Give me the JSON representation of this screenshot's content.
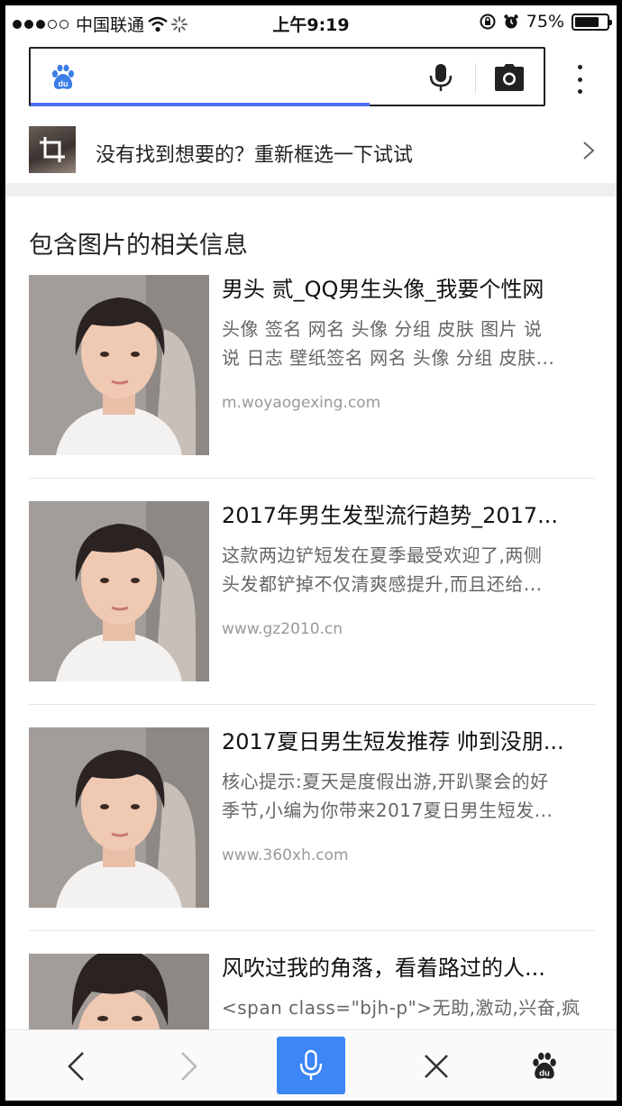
{
  "status_bar": {
    "carrier": "中国联通",
    "time": "上午9:19",
    "battery_text": "75%",
    "battery_level": 0.75
  },
  "search": {
    "query": "",
    "load_progress": 0.66
  },
  "reselect": {
    "text": "没有找到想要的？重新框选一下试试"
  },
  "section": {
    "title": "包含图片的相关信息"
  },
  "results": [
    {
      "title": "男头 贰_QQ男生头像_我要个性网",
      "desc_line1": "头像 签名 网名 头像 分组 皮肤 图片 说",
      "desc_line2": "说 日志 壁纸签名 网名 头像 分组 皮肤...",
      "url": "m.woyaogexing.com"
    },
    {
      "title": "2017年男生发型流行趋势_2017...",
      "desc_line1": "这款两边铲短发在夏季最受欢迎了,两侧",
      "desc_line2": "头发都铲掉不仅清爽感提升,而且还给...",
      "url": "www.gz2010.cn"
    },
    {
      "title": "2017夏日男生短发推荐 帅到没朋...",
      "desc_line1": "核心提示:夏天是度假出游,开趴聚会的好",
      "desc_line2": "季节,小编为你带来2017夏日男生短发...",
      "url": "www.360xh.com"
    },
    {
      "title": "风吹过我的角落，看着路过的人...",
      "desc_line1": "<span class=\"bjh-p\">无助,激动,兴奋,疯",
      "desc_line2": "",
      "url": ""
    }
  ],
  "icons": {
    "baidu": "baidu-paw-icon",
    "mic": "microphone-icon",
    "camera": "camera-icon",
    "more": "more-vertical-icon",
    "crop": "crop-icon",
    "chevron": "chevron-right-icon",
    "back": "arrow-left-icon",
    "forward": "arrow-right-icon",
    "close": "close-icon"
  },
  "colors": {
    "accent": "#3c86f5",
    "progress": "#4e6ef2"
  }
}
